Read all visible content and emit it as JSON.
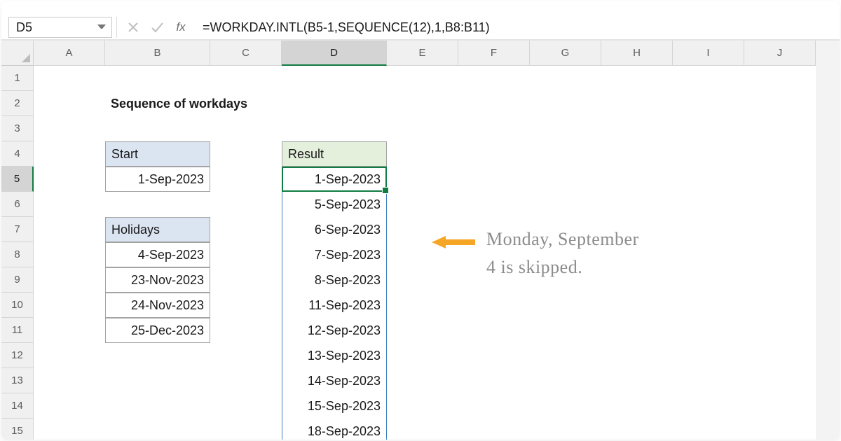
{
  "cell_ref": "D5",
  "formula": "=WORKDAY.INTL(B5-1,SEQUENCE(12),1,B8:B11)",
  "columns": [
    "A",
    "B",
    "C",
    "D",
    "E",
    "F",
    "G",
    "H",
    "I",
    "J"
  ],
  "rows": [
    "1",
    "2",
    "3",
    "4",
    "5",
    "6",
    "7",
    "8",
    "9",
    "10",
    "11",
    "12",
    "13",
    "14",
    "15"
  ],
  "title": "Sequence of workdays",
  "start_header": "Start",
  "start_value": "1-Sep-2023",
  "holidays_header": "Holidays",
  "holidays": [
    "4-Sep-2023",
    "23-Nov-2023",
    "24-Nov-2023",
    "25-Dec-2023"
  ],
  "result_header": "Result",
  "results": [
    "1-Sep-2023",
    "5-Sep-2023",
    "6-Sep-2023",
    "7-Sep-2023",
    "8-Sep-2023",
    "11-Sep-2023",
    "12-Sep-2023",
    "13-Sep-2023",
    "14-Sep-2023",
    "15-Sep-2023",
    "18-Sep-2023"
  ],
  "annotation_l1": "Monday, September",
  "annotation_l2": "4 is skipped."
}
